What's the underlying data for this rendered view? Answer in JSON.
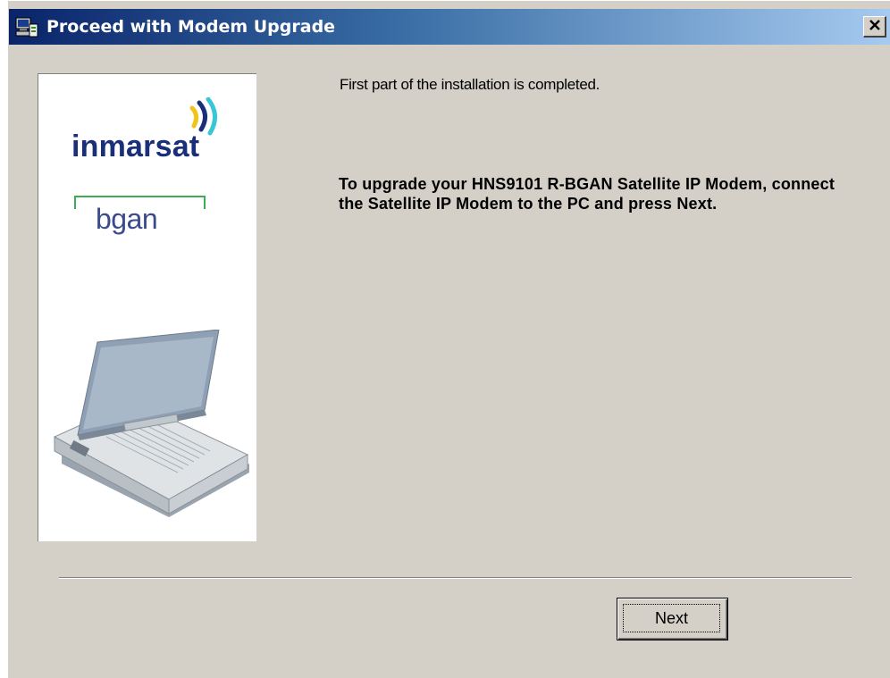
{
  "window": {
    "title": "Proceed with Modem Upgrade",
    "close_symbol": "×"
  },
  "branding": {
    "brand_name": "inmarsat",
    "product_name": "bgan"
  },
  "content": {
    "info": "First part of the installation is completed.",
    "instruction": "To upgrade your HNS9101 R-BGAN Satellite IP Modem,  connect the Satellite IP Modem to the PC and press Next."
  },
  "buttons": {
    "next_label": "Next"
  },
  "icons": {
    "title": "setup-computer-icon",
    "close": "close-icon"
  },
  "colors": {
    "titlebar_start": "#0a246a",
    "titlebar_end": "#a6caf0",
    "dialog_bg": "#d4d0c8",
    "brand_blue": "#1a2f7a",
    "brand_green": "#3cae52"
  }
}
